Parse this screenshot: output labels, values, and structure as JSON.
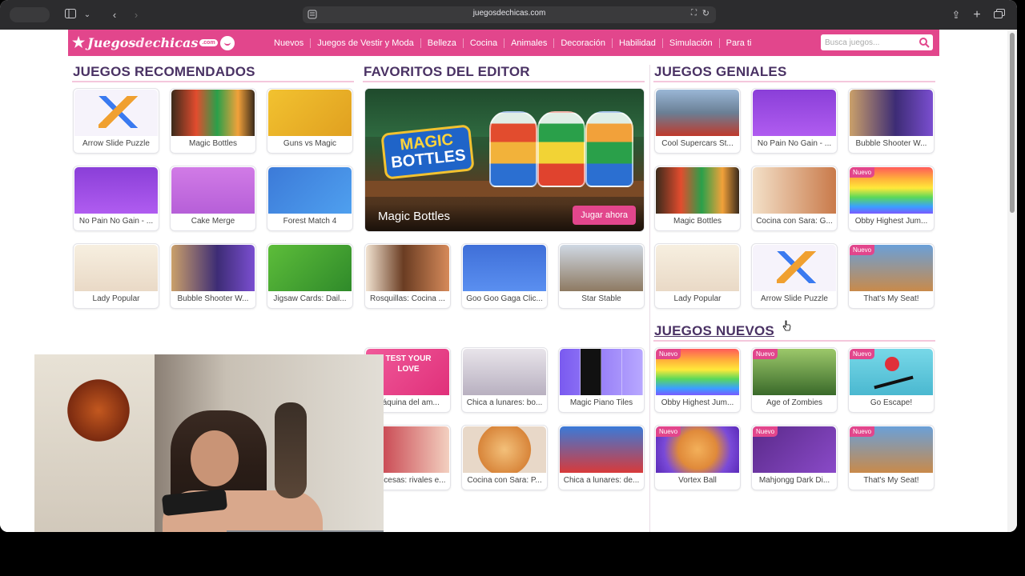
{
  "browser": {
    "url": "juegosdechicas.com"
  },
  "site": {
    "logo_parts": [
      "Juegos",
      "de",
      "chicas"
    ],
    "logo_suffix": ".com",
    "nav": [
      "Nuevos",
      "Juegos de Vestir y Moda",
      "Belleza",
      "Cocina",
      "Animales",
      "Decoración",
      "Habilidad",
      "Simulación",
      "Para ti"
    ],
    "search_placeholder": "Busca juegos..."
  },
  "sections": {
    "recomendados": "JUEGOS RECOMENDADOS",
    "favoritos": "FAVORITOS DEL EDITOR",
    "geniales": "JUEGOS GENIALES",
    "nuevos": "JUEGOS NUEVOS"
  },
  "featured": {
    "art_line1": "MAGIC",
    "art_line2": "BOTTLES",
    "title": "Magic Bottles",
    "button": "Jugar ahora"
  },
  "new_badge": "Nuevo",
  "recomendados_cards": [
    {
      "label": "Arrow Slide Puzzle",
      "thumb": "arrow"
    },
    {
      "label": "Magic Bottles",
      "thumb": "bottles"
    },
    {
      "label": "Guns vs Magic",
      "thumb": "guns"
    },
    {
      "label": "No Pain No Gain - ...",
      "thumb": "nopain"
    },
    {
      "label": "Cake Merge",
      "thumb": "cake"
    },
    {
      "label": "Forest Match 4",
      "thumb": "forest"
    },
    {
      "label": "Lady Popular",
      "thumb": "lady"
    },
    {
      "label": "Bubble Shooter W...",
      "thumb": "bubble"
    },
    {
      "label": "Jigsaw Cards: Dail...",
      "thumb": "jigsaw"
    }
  ],
  "favoritos_row3_cards": [
    {
      "label": "Rosquillas: Cocina ...",
      "thumb": "donuts"
    },
    {
      "label": "Goo Goo Gaga Clic...",
      "thumb": "googoo"
    },
    {
      "label": "Star Stable",
      "thumb": "star"
    }
  ],
  "partial_left_cards": [
    {
      "label": "Máquina del am...",
      "thumb": "love",
      "line1": "TEST YOUR",
      "line2": "LOVE"
    },
    {
      "label": "Princesas: rivales e...",
      "thumb": "princess"
    }
  ],
  "middle_lower_cards": [
    {
      "label": "Chica a lunares: bo...",
      "thumb": "bride"
    },
    {
      "label": "Magic Piano Tiles",
      "thumb": "piano"
    },
    {
      "label": "Cocina con Sara: P...",
      "thumb": "pizza"
    },
    {
      "label": "Chica a lunares: de...",
      "thumb": "ladybug"
    }
  ],
  "geniales_cards": [
    {
      "label": "Cool Supercars St...",
      "thumb": "cars",
      "new": false
    },
    {
      "label": "No Pain No Gain - ...",
      "thumb": "nopain",
      "new": false
    },
    {
      "label": "Bubble Shooter W...",
      "thumb": "bubble",
      "new": false
    },
    {
      "label": "Magic Bottles",
      "thumb": "bottles",
      "new": false
    },
    {
      "label": "Cocina con Sara: G...",
      "thumb": "sara",
      "new": false
    },
    {
      "label": "Obby Highest Jum...",
      "thumb": "obby",
      "new": true
    },
    {
      "label": "Lady Popular",
      "thumb": "lady",
      "new": false
    },
    {
      "label": "Arrow Slide Puzzle",
      "thumb": "arrow",
      "new": false
    },
    {
      "label": "That's My Seat!",
      "thumb": "seat",
      "new": true
    }
  ],
  "nuevos_cards": [
    {
      "label": "Obby Highest Jum...",
      "thumb": "obby",
      "new": true
    },
    {
      "label": "Age of Zombies",
      "thumb": "zombies",
      "new": true
    },
    {
      "label": "Go Escape!",
      "thumb": "escape",
      "new": true
    },
    {
      "label": "Vortex Ball",
      "thumb": "vortex",
      "new": true
    },
    {
      "label": "Mahjongg Dark Di...",
      "thumb": "mahjong",
      "new": true
    },
    {
      "label": "That's My Seat!",
      "thumb": "seat",
      "new": true
    }
  ]
}
